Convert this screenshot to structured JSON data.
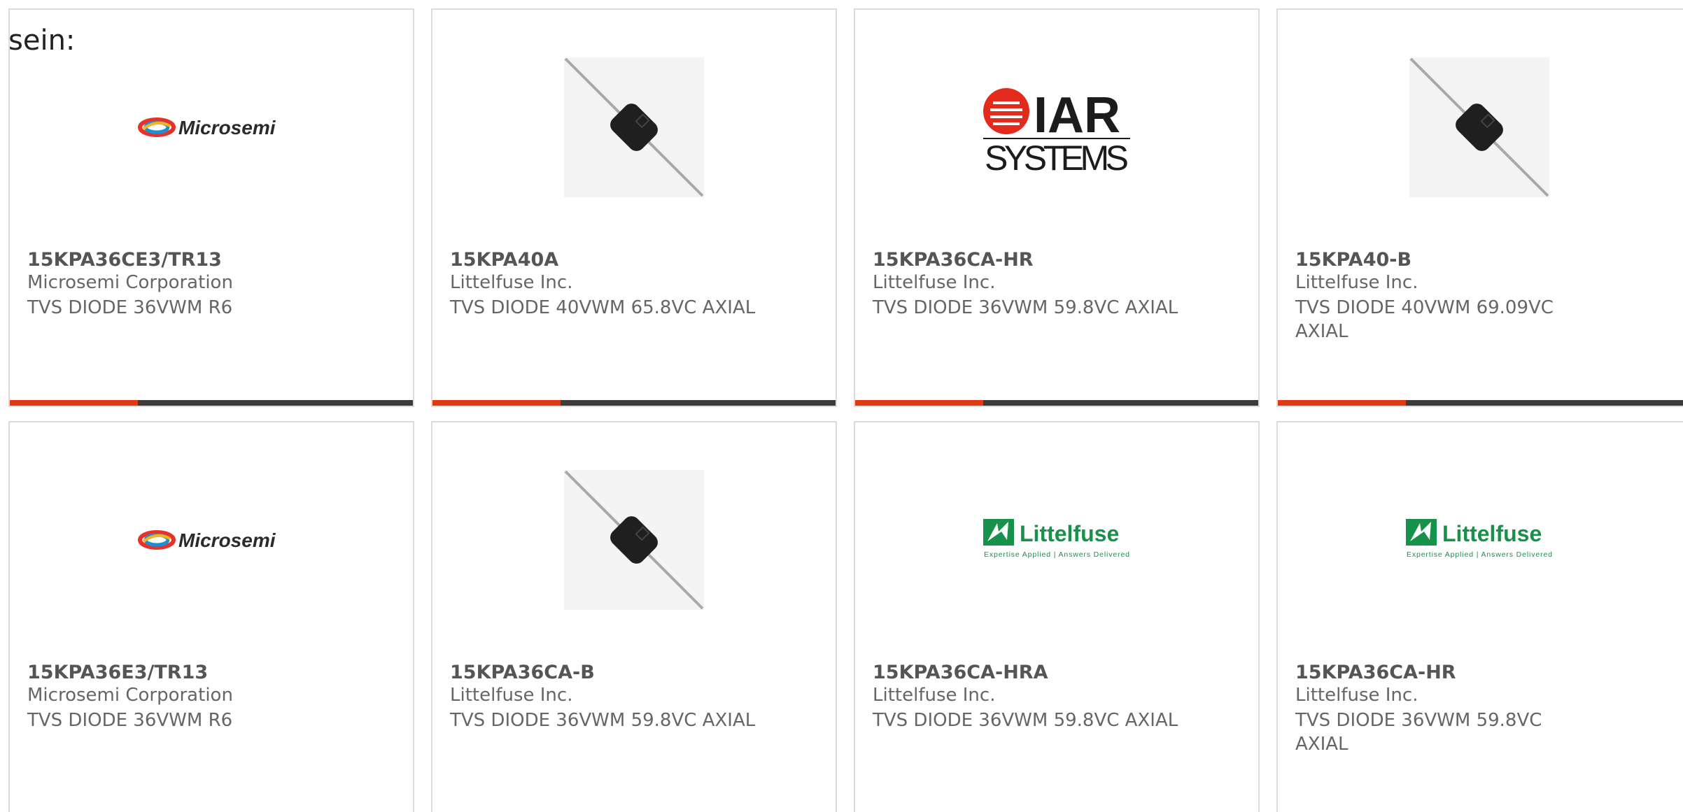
{
  "lead_text": "sein:",
  "colors": {
    "card_border": "#dcdcdc",
    "accent_red": "#e03a12",
    "accent_dark": "#3b3b3b",
    "part_number": "#555555",
    "meta_text": "#666666"
  },
  "cards": [
    {
      "part_number": "15KPA36CE3/TR13",
      "manufacturer": "Microsemi Corporation",
      "description": "TVS DIODE 36VWM R6",
      "image": "microsemi-logo",
      "logo_text": "Microsemi"
    },
    {
      "part_number": "15KPA40A",
      "manufacturer": "Littelfuse Inc.",
      "description": "TVS DIODE 40VWM 65.8VC AXIAL",
      "image": "axial-diode-photo"
    },
    {
      "part_number": "15KPA36CA-HR",
      "manufacturer": "Littelfuse Inc.",
      "description": "TVS DIODE 36VWM 59.8VC AXIAL",
      "image": "iar-systems-logo",
      "logo_text": "IAR",
      "logo_subtext": "SYSTEMS"
    },
    {
      "part_number": "15KPA40-B",
      "manufacturer": "Littelfuse Inc.",
      "description": "TVS DIODE 40VWM 69.09VC AXIAL",
      "image": "axial-diode-photo"
    },
    {
      "part_number": "15KPA36E3/TR13",
      "manufacturer": "Microsemi Corporation",
      "description": "TVS DIODE 36VWM R6",
      "image": "microsemi-logo",
      "logo_text": "Microsemi"
    },
    {
      "part_number": "15KPA36CA-B",
      "manufacturer": "Littelfuse Inc.",
      "description": "TVS DIODE 36VWM 59.8VC AXIAL",
      "image": "axial-diode-photo"
    },
    {
      "part_number": "15KPA36CA-HRA",
      "manufacturer": "Littelfuse Inc.",
      "description": "TVS DIODE 36VWM 59.8VC AXIAL",
      "image": "littelfuse-logo",
      "logo_text": "Littelfuse",
      "logo_tagline": "Expertise Applied | Answers Delivered"
    },
    {
      "part_number": "15KPA36CA-HR",
      "manufacturer": "Littelfuse Inc.",
      "description": "TVS DIODE 36VWM 59.8VC AXIAL",
      "image": "littelfuse-logo",
      "logo_text": "Littelfuse",
      "logo_tagline": "Expertise Applied | Answers Delivered"
    }
  ]
}
